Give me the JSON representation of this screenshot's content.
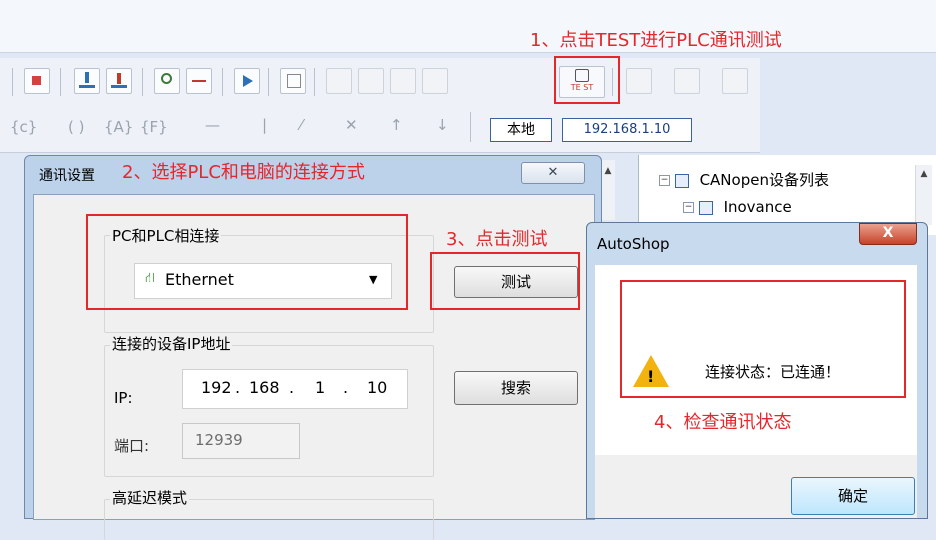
{
  "annotations": {
    "step1": "1、点击TEST进行PLC通讯测试",
    "step2": "2、选择PLC和电脑的连接方式",
    "step3": "3、点击测试",
    "step4": "4、检查通讯状态"
  },
  "toolbar": {
    "test_icon_label": "TE ST",
    "local_label": "本地",
    "ip_label": "192.168.1.10"
  },
  "tree": {
    "items": [
      "CANopen设备列表",
      "Inovance"
    ]
  },
  "comm_dialog": {
    "title": "通讯设置",
    "close_glyph": "✕",
    "connection_group": {
      "label": "PC和PLC相连接",
      "selected": "Ethernet"
    },
    "test_button": "测试",
    "ip_group": {
      "label": "连接的设备IP地址",
      "ip_label": "IP:",
      "ip_parts": [
        "192",
        "168",
        "1",
        "10"
      ],
      "port_label": "端口:",
      "port_value": "12939"
    },
    "search_button": "搜索",
    "latency_group": {
      "label": "高延迟模式"
    }
  },
  "msg_box": {
    "title": "AutoShop",
    "close_glyph": "X",
    "message": "连接状态：已连通！",
    "ok_button": "确定"
  },
  "colors": {
    "annotation_red": "#e4272b",
    "ip_text_blue": "#1b3f80"
  }
}
